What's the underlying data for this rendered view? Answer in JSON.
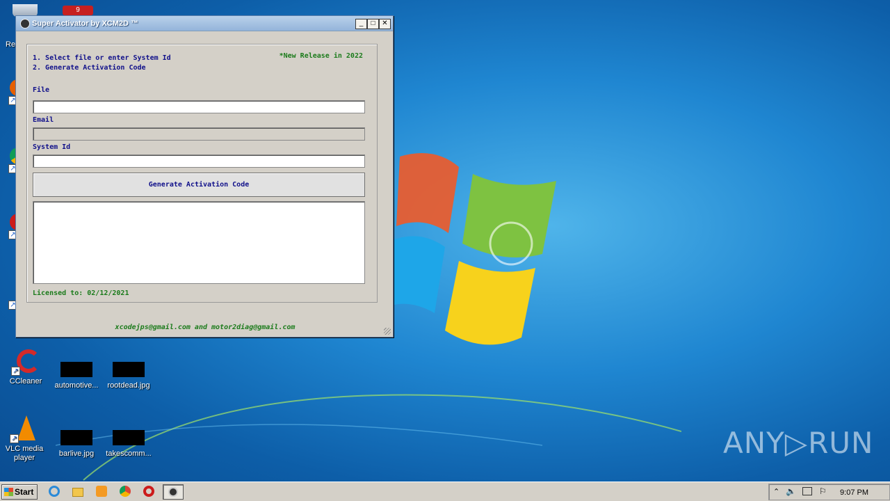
{
  "window": {
    "title": "Super Activator by XCM2D ™",
    "controls": {
      "minimize": "_",
      "maximize": "□",
      "close": "✕"
    },
    "instructions": [
      "1. Select file or enter System Id",
      "2. Generate Activation Code"
    ],
    "release_note": "*New Release in 2022",
    "file_label": "File",
    "file_value": "",
    "email_label": "Email",
    "email_value": "",
    "system_id_label": "System Id",
    "system_id_value": "",
    "generate_button": "Generate Activation Code",
    "output_value": "",
    "licensed": "Licensed to: 02/12/2021",
    "footer_contact": "xcodejps@gmail.com and motor2diag@gmail.com"
  },
  "desktop": {
    "partial_label": "Re",
    "icons": [
      {
        "label": "CCleaner",
        "type": "ccleaner-icon"
      },
      {
        "label": "automotive...",
        "type": "image-file-icon"
      },
      {
        "label": "rootdead.jpg",
        "type": "image-file-icon"
      },
      {
        "label": "VLC media player",
        "type": "vlc-icon"
      },
      {
        "label": "barlive.jpg",
        "type": "image-file-icon"
      },
      {
        "label": "takescomm...",
        "type": "image-file-icon"
      }
    ],
    "badge_count": "9"
  },
  "taskbar": {
    "start_label": "Start",
    "clock": "9:07 PM",
    "apps": [
      "ie-icon",
      "explorer-icon",
      "media-player-icon",
      "chrome-icon",
      "opera-icon",
      "activator-app-icon"
    ],
    "tray": [
      "show-hidden-icon",
      "volume-icon",
      "network-icon",
      "flag-icon"
    ]
  },
  "watermark": "ANY▷RUN",
  "colors": {
    "window_bg": "#d4d0c8",
    "label_blue": "#10108a",
    "label_green": "#1b7b1b",
    "desktop_blue": "#1f86d1"
  }
}
